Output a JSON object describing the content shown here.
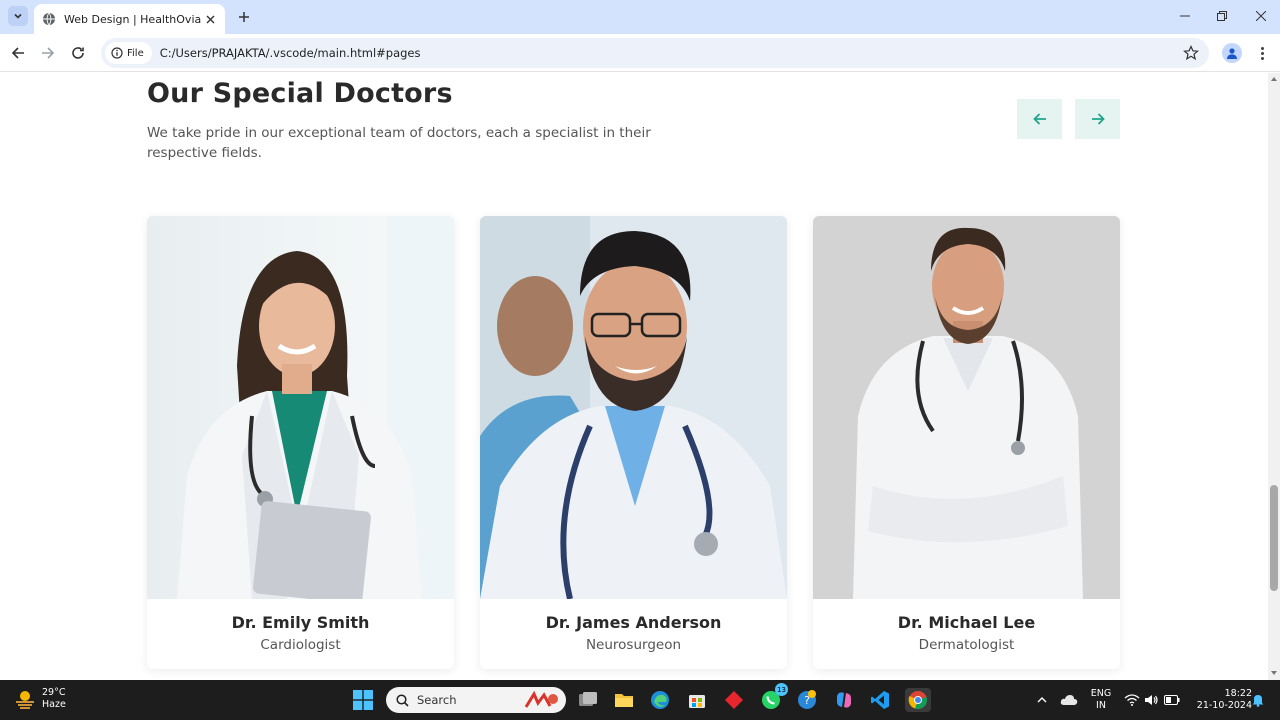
{
  "browser": {
    "tab_title": "Web Design | HealthOvia",
    "chip_label": "File",
    "url": "C:/Users/PRAJAKTA/.vscode/main.html#pages"
  },
  "section": {
    "title": "Our Special Doctors",
    "description": "We take pride in our exceptional team of doctors, each a specialist in their respective fields."
  },
  "doctors": [
    {
      "name": "Dr. Emily Smith",
      "specialty": "Cardiologist"
    },
    {
      "name": "Dr. James Anderson",
      "specialty": "Neurosurgeon"
    },
    {
      "name": "Dr. Michael Lee",
      "specialty": "Dermatologist"
    }
  ],
  "colors": {
    "accent": "#1fa589",
    "arrow_bg": "#e6f4f1"
  },
  "taskbar": {
    "temperature": "29°C",
    "weather": "Haze",
    "search_label": "Search",
    "whatsapp_badge": "13",
    "lang_top": "ENG",
    "lang_bottom": "IN",
    "time": "18:22",
    "date": "21-10-2024"
  }
}
